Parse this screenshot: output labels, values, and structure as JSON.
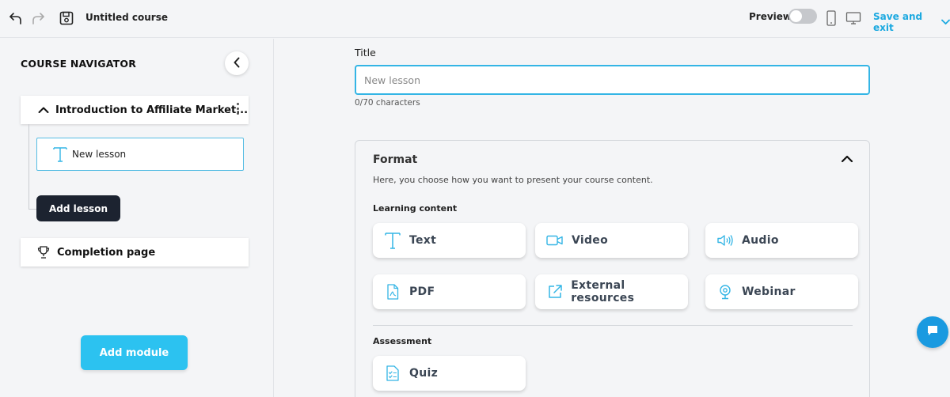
{
  "header": {
    "course_title": "Untitled course",
    "preview_label": "Preview",
    "save_exit_label": "Save and exit",
    "accent_color": "#1ca9e0"
  },
  "sidebar": {
    "title": "COURSE NAVIGATOR",
    "module": {
      "label": "Introduction to Affiliate Market...",
      "lessons": [
        {
          "label": "New lesson",
          "icon": "text-icon"
        }
      ]
    },
    "add_lesson_label": "Add lesson",
    "completion_label": "Completion page",
    "add_module_label": "Add module"
  },
  "main": {
    "title_label": "Title",
    "title_placeholder": "New lesson",
    "char_count": "0/70 characters",
    "format": {
      "title": "Format",
      "description": "Here, you choose how you want to present your course content.",
      "learning_label": "Learning content",
      "learning_items": [
        {
          "label": "Text",
          "icon": "text-icon"
        },
        {
          "label": "Video",
          "icon": "video-icon"
        },
        {
          "label": "Audio",
          "icon": "audio-icon"
        },
        {
          "label": "PDF",
          "icon": "pdf-icon"
        },
        {
          "label": "External resources",
          "icon": "external-link-icon"
        },
        {
          "label": "Webinar",
          "icon": "webinar-icon"
        }
      ],
      "assessment_label": "Assessment",
      "assessment_items": [
        {
          "label": "Quiz",
          "icon": "quiz-icon"
        }
      ]
    }
  },
  "icon_color": "#34b5e5"
}
